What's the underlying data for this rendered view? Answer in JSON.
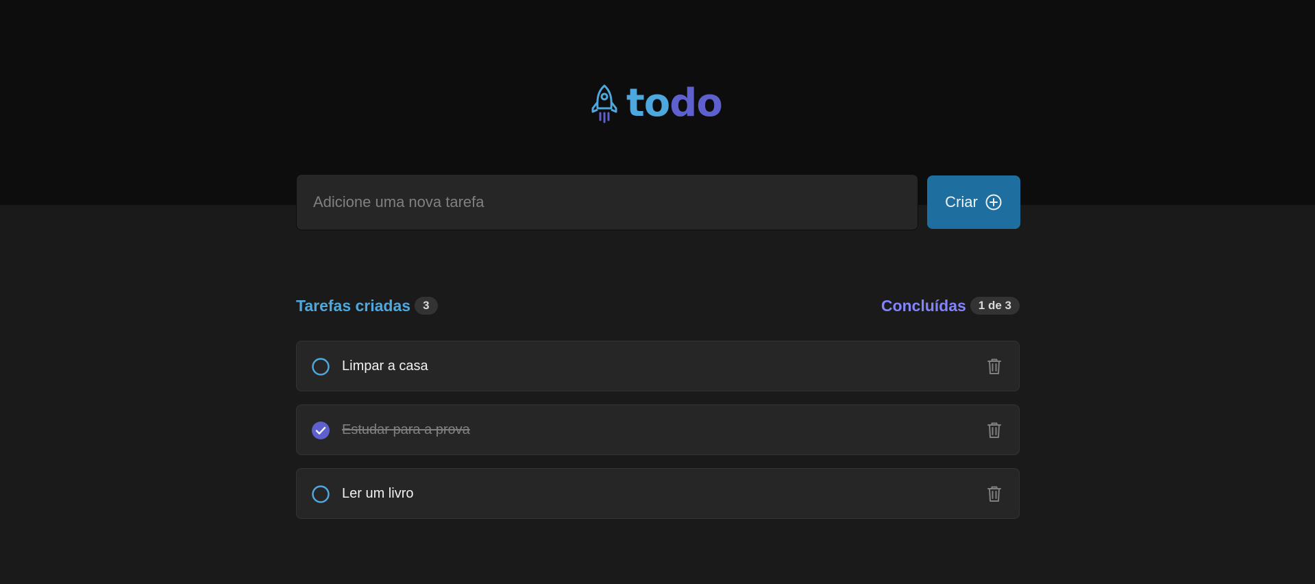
{
  "app": {
    "logo_part1": "to",
    "logo_part2": "do",
    "logo_icon": "rocket-icon"
  },
  "add_task": {
    "placeholder": "Adicione uma nova tarefa",
    "value": "",
    "button_label": "Criar",
    "button_icon": "plus-circle-icon"
  },
  "info": {
    "created_label": "Tarefas criadas",
    "created_count": "3",
    "done_label": "Concluídas",
    "done_count": "1 de 3"
  },
  "tasks": [
    {
      "text": "Limpar a casa",
      "completed": false
    },
    {
      "text": "Estudar para a prova",
      "completed": true
    },
    {
      "text": "Ler um livro",
      "completed": false
    }
  ],
  "colors": {
    "blue": "#4ea8de",
    "purple": "#5e60ce",
    "purple_light": "#8284fa",
    "button": "#1e6f9f",
    "header_bg": "#0d0d0d",
    "body_bg": "#1a1a1a",
    "card_bg": "#262626"
  }
}
